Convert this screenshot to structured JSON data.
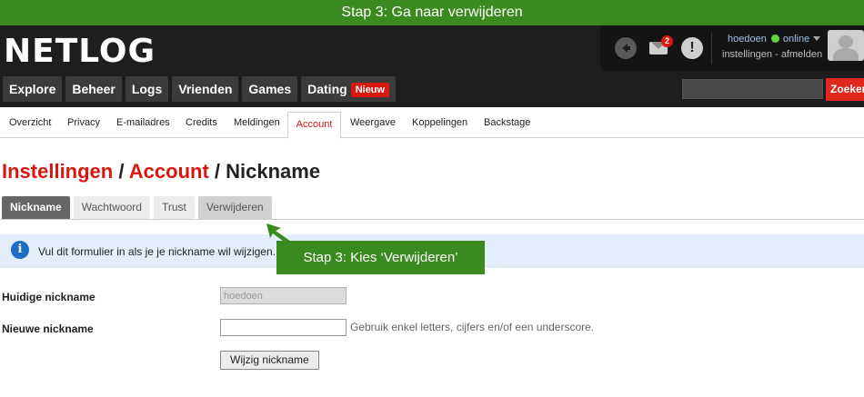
{
  "banner": {
    "text": "Stap 3: Ga naar verwijderen"
  },
  "brand": {
    "logo": "NETLOG"
  },
  "user": {
    "name": "hoedoen",
    "status": "online",
    "links": "instellingen - afmelden",
    "message_count": "2"
  },
  "main_nav": [
    {
      "label": "Explore"
    },
    {
      "label": "Beheer"
    },
    {
      "label": "Logs"
    },
    {
      "label": "Vrienden"
    },
    {
      "label": "Games"
    },
    {
      "label": "Dating",
      "badge": "Nieuw"
    }
  ],
  "search": {
    "button": "Zoeken",
    "placeholder": ""
  },
  "sub_nav": [
    {
      "label": "Overzicht"
    },
    {
      "label": "Privacy"
    },
    {
      "label": "E-mailadres"
    },
    {
      "label": "Credits"
    },
    {
      "label": "Meldingen"
    },
    {
      "label": "Account",
      "active": true
    },
    {
      "label": "Weergave"
    },
    {
      "label": "Koppelingen"
    },
    {
      "label": "Backstage"
    }
  ],
  "page_title": {
    "part1": "Instellingen",
    "sep1": " / ",
    "part2": "Account",
    "sep2": " / ",
    "part3": "Nickname"
  },
  "tabs": [
    {
      "label": "Nickname",
      "active": true
    },
    {
      "label": "Wachtwoord"
    },
    {
      "label": "Trust"
    },
    {
      "label": "Verwijderen"
    }
  ],
  "info": {
    "text": "Vul dit formulier in als je je nickname wil wijzigen."
  },
  "callout": {
    "text": "Stap 3: Kies ‘Verwijderen’"
  },
  "form": {
    "current_label": "Huidige nickname",
    "current_value": "hoedoen",
    "new_label": "Nieuwe nickname",
    "new_value": "",
    "hint": "Gebruik enkel letters, cijfers en/of een underscore.",
    "submit": "Wijzig nickname"
  },
  "colors": {
    "accent_red": "#d8170e",
    "banner_green": "#3a8a1f",
    "topbar": "#1e1e1e",
    "info_bg": "#e4eefb"
  }
}
